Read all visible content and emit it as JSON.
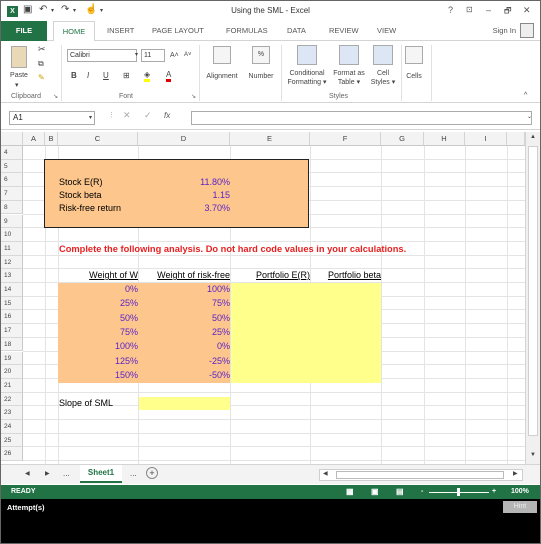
{
  "window": {
    "title": "Using the SML - Excel",
    "help": "?",
    "minimize": "–",
    "restore": "🗗",
    "close": "✕"
  },
  "tabs": {
    "file": "FILE",
    "home": "HOME",
    "insert": "INSERT",
    "page_layout": "PAGE LAYOUT",
    "formulas": "FORMULAS",
    "data": "DATA",
    "review": "REVIEW",
    "view": "VIEW",
    "sign_in": "Sign In"
  },
  "ribbon": {
    "paste": "Paste",
    "clipboard": "Clipboard",
    "font_name": "Calibri",
    "font_size": "11",
    "bold": "B",
    "italic": "I",
    "underline": "U",
    "font": "Font",
    "alignment": "Alignment",
    "number": "Number",
    "conditional": "Conditional",
    "formatting": "Formatting",
    "format_as": "Format as",
    "table": "Table",
    "cell": "Cell",
    "styles_btn": "Styles",
    "styles": "Styles",
    "cells": "Cells"
  },
  "formula_bar": {
    "name_box": "A1",
    "fx": "fx",
    "value": ""
  },
  "columns": [
    "A",
    "B",
    "C",
    "D",
    "E",
    "F",
    "G",
    "H",
    "I"
  ],
  "rows": [
    "4",
    "5",
    "6",
    "7",
    "8",
    "9",
    "10",
    "11",
    "12",
    "13",
    "14",
    "15",
    "16",
    "17",
    "18",
    "19",
    "20",
    "21",
    "22",
    "23",
    "24",
    "25",
    "26"
  ],
  "sheet": {
    "stock_er_label": "Stock E(R)",
    "stock_er": "11.80%",
    "stock_beta_label": "Stock beta",
    "stock_beta": "1.15",
    "rf_label": "Risk-free return",
    "rf": "3.70%",
    "instruction": "Complete the following analysis. Do not hard code values in your calculations.",
    "headers": [
      "Weight of W",
      "Weight of risk-free",
      "Portfolio E(R)",
      "Portfolio beta"
    ],
    "weights_w": [
      "0%",
      "25%",
      "50%",
      "75%",
      "100%",
      "125%",
      "150%"
    ],
    "weights_rf": [
      "100%",
      "75%",
      "50%",
      "25%",
      "0%",
      "-25%",
      "-50%"
    ],
    "slope_label": "Slope of SML"
  },
  "sheet_tabs": {
    "ellipsis_left": "...",
    "active": "Sheet1",
    "ellipsis_right": "...",
    "add": "+"
  },
  "status": {
    "ready": "READY",
    "zoom": "100%",
    "minus": "-",
    "plus": "+"
  },
  "attempt": {
    "label": "Attempt(s)",
    "hint": "Hint"
  },
  "colors": {
    "excel_green": "#217346",
    "orange_fill": "#fcc68c",
    "yellow_fill": "#ffff8c",
    "blue_text": "#5b22c8",
    "red_text": "#e82020"
  }
}
